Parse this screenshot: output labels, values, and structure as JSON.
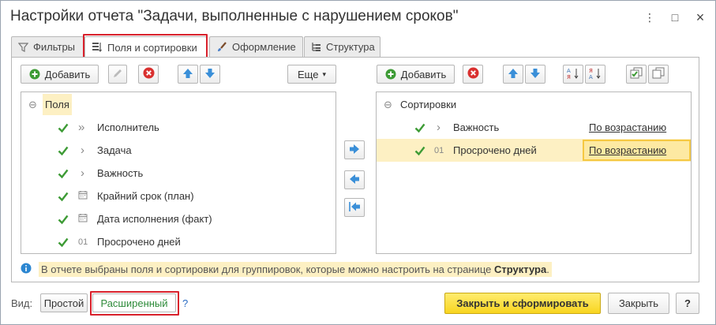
{
  "window": {
    "title": "Настройки отчета \"Задачи, выполненные с нарушением сроков\"",
    "more_label": "⋮",
    "maximize_label": "□",
    "close_label": "×"
  },
  "tabs": [
    {
      "label": "Фильтры"
    },
    {
      "label": "Поля и сортировки"
    },
    {
      "label": "Оформление"
    },
    {
      "label": "Структура"
    }
  ],
  "fields_toolbar": {
    "add_label": "Добавить",
    "more_label": "Еще",
    "more_arrow": "▾"
  },
  "fields_tree": {
    "root_label": "Поля",
    "items": [
      {
        "label": "Исполнитель",
        "marker": "»"
      },
      {
        "label": "Задача",
        "marker": "›"
      },
      {
        "label": "Важность",
        "marker": "›"
      },
      {
        "label": "Крайний срок (план)",
        "marker": "calendar"
      },
      {
        "label": "Дата исполнения (факт)",
        "marker": "calendar"
      },
      {
        "label": "Просрочено дней",
        "marker": "01"
      }
    ]
  },
  "sort_toolbar": {
    "add_label": "Добавить"
  },
  "sort_tree": {
    "root_label": "Сортировки",
    "items": [
      {
        "marker": "›",
        "label": "Важность",
        "direction": "По возрастанию"
      },
      {
        "marker": "01",
        "label": "Просрочено дней",
        "direction": "По возрастанию"
      }
    ]
  },
  "info": {
    "text_before": "В отчете выбраны поля и сортировки для группировок, которые можно настроить на странице ",
    "link_word": "Структура",
    "text_after": "."
  },
  "footer": {
    "view_label": "Вид:",
    "simple_label": "Простой",
    "extended_label": "Расширенный",
    "help_label": "?",
    "apply_label": "Закрыть и сформировать",
    "close_label": "Закрыть",
    "question_label": "?"
  },
  "colors": {
    "accent_yellow": "#fde34a",
    "highlight": "#fdf0c3",
    "check_green": "#3d9b35",
    "red_outline": "#d9212c",
    "blue_arrow": "#3a8fd8"
  }
}
